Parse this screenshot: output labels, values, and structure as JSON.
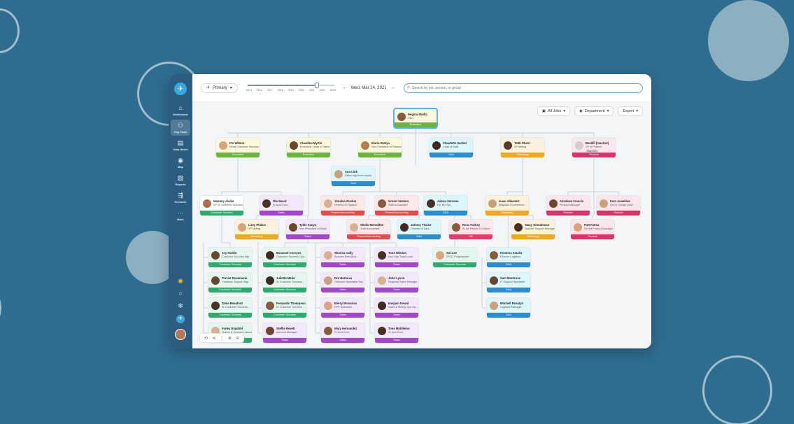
{
  "header": {
    "view_label": "Primary",
    "timeline_years": [
      "2013",
      "2016",
      "2017",
      "2018",
      "2019",
      "2020",
      "2021",
      "2022",
      "2023"
    ],
    "timeline_position": 0.8,
    "date": "Wed, Mar 24, 2021",
    "search_placeholder": "Search by job, person, or group"
  },
  "sidebar": {
    "items": [
      {
        "label": "Dashboard",
        "icon": "home-icon"
      },
      {
        "label": "Org Chart",
        "icon": "org-chart-icon"
      },
      {
        "label": "Data Sheet",
        "icon": "data-sheet-icon"
      },
      {
        "label": "Map",
        "icon": "map-pin-icon"
      },
      {
        "label": "Reports",
        "icon": "reports-icon"
      },
      {
        "label": "Scenario",
        "icon": "scenario-icon"
      },
      {
        "label": "More",
        "icon": "more-icon"
      }
    ]
  },
  "filters": {
    "jobs": "All Jobs",
    "department": "Department",
    "export": "Export"
  },
  "colors": {
    "Executive": "#6db33f",
    "G&A": "#2d8bd0",
    "Marketing": "#f0a822",
    "Product": "#d8336b",
    "Customer Success": "#2faa6e",
    "Sales": "#a148c9",
    "Finance/Accounting": "#e24b4b",
    "HR": "#e23c6a"
  },
  "cards": [
    {
      "id": "ceo",
      "name": "Regina Shelta",
      "title": "CEO",
      "dept": "Executive",
      "tint": "#fbf7dc",
      "skin": "#8a5a3c"
    },
    {
      "id": "c1",
      "name": "Flo Wilmar",
      "title": "Head Customer Success",
      "dept": "Executive",
      "tint": "#fbf7dc",
      "skin": "#d9a47e"
    },
    {
      "id": "c2",
      "name": "Claudina Myrtle",
      "title": "President, Head of Sales",
      "dept": "Executive",
      "tint": "#fbf7dc",
      "skin": "#6b4630"
    },
    {
      "id": "c3",
      "name": "Elaria Zamya",
      "title": "Vice President of Finance",
      "dept": "Executive",
      "tint": "#fbf7dc",
      "skin": "#b57a52"
    },
    {
      "id": "c4",
      "name": "Claudette Sachet",
      "title": "Chief of Staff",
      "dept": "G&A",
      "tint": "#dcf6fb",
      "skin": "#3e2a1e"
    },
    {
      "id": "c5",
      "name": "Tabb Sharri",
      "title": "VP Mkting",
      "dept": "Marketing",
      "tint": "#fbf1dc",
      "skin": "#5a3a28"
    },
    {
      "id": "c6",
      "name": "Bealifil (Inactive)",
      "title": "VP of Product",
      "dept": "Product",
      "tint": "#fbe6ec",
      "skin": "#cfcfcf",
      "badge": "May 2021"
    },
    {
      "id": "ea",
      "name": "Ann Link",
      "title": "Office Mgr/Exec Assist",
      "dept": "G&A",
      "tint": "#dcf6fb",
      "skin": "#c9a17e"
    },
    {
      "id": "r1",
      "name": "Mommy Alsike",
      "title": "VP of Customer Success",
      "dept": "Customer Success",
      "tint": "#ffffff",
      "skin": "#a8704e"
    },
    {
      "id": "r2",
      "name": "Ola Wood",
      "title": "Sr Acct Exec",
      "dept": "Sales",
      "tint": "#f3e8fb",
      "skin": "#4a3024"
    },
    {
      "id": "r3",
      "name": "Yenelon Rocker",
      "title": "Director of Finance",
      "dept": "Finance/Accounting",
      "tint": "#fbe8e8",
      "skin": "#d9b094"
    },
    {
      "id": "r4",
      "name": "Grezel Ventura",
      "title": "Staff Accountant",
      "dept": "Finance/Accounting",
      "tint": "#fbe8e8",
      "skin": "#8a5a3c"
    },
    {
      "id": "r5",
      "name": "Adena Sorvena",
      "title": "Dir. Biz Sys",
      "dept": "G&A",
      "tint": "#dcf6fb",
      "skin": "#4a3024"
    },
    {
      "id": "r6",
      "name": "Isaac Allaanert",
      "title": "Mktplace Ecommerce ...",
      "dept": "Marketing",
      "tint": "#fbf1dc",
      "skin": "#c9a17e"
    },
    {
      "id": "r7",
      "name": "Abraham Francis",
      "title": "Product Manager",
      "dept": "Product",
      "tint": "#fbe6ec",
      "skin": "#6b4630"
    },
    {
      "id": "r8",
      "name": "Fern Anaaklue",
      "title": "UI/UX Design Lead",
      "dept": "Product",
      "tint": "#fbe6ec",
      "skin": "#c9a17e"
    },
    {
      "id": "s1",
      "name": "Lizzy Plakus",
      "title": "VP Mkting",
      "dept": "Marketing",
      "tint": "#fbf1dc",
      "skin": "#d9a47e"
    },
    {
      "id": "s2",
      "name": "Tyble Sanyo",
      "title": "Vice President of Sales",
      "dept": "Sales",
      "tint": "#f3e8fb",
      "skin": "#6b4630"
    },
    {
      "id": "s3",
      "name": "Shella Meredithe",
      "title": "Staff Accountant",
      "dept": "Finance/Accounting",
      "tint": "#fbe8e8",
      "skin": "#d9b094"
    },
    {
      "id": "s4",
      "name": "Johnny Thaine",
      "title": "Director of Data",
      "dept": "G&A",
      "tint": "#dcf6fb",
      "skin": "#3e2a1e"
    },
    {
      "id": "s5",
      "name": "Ross Forkey",
      "title": "Sr Dir People & Culture",
      "dept": "HR",
      "tint": "#fbe6ec",
      "skin": "#8a5a3c"
    },
    {
      "id": "s6",
      "name": "Stasy Hinnahman",
      "title": "Teacher Support Manager",
      "dept": "Marketing",
      "tint": "#fbf1dc",
      "skin": "#4a3024"
    },
    {
      "id": "s7",
      "name": "Patt Fatma",
      "title": "Senior Product Manager",
      "dept": "Product",
      "tint": "#fbe6ec",
      "skin": "#d9a47e"
    },
    {
      "id": "t1",
      "name": "Joy Harkin",
      "title": "Customer Success Mgr",
      "dept": "Customer Success",
      "tint": "#e3f7ee",
      "skin": "#6b4630"
    },
    {
      "id": "t2",
      "name": "Emanuel Cornyns",
      "title": "Customer Success Ops...",
      "dept": "Customer Success",
      "tint": "#e3f7ee",
      "skin": "#3e2a1e"
    },
    {
      "id": "t3",
      "name": "Sharisa Colly",
      "title": "Account Executive",
      "dept": "Sales",
      "tint": "#f3e8fb",
      "skin": "#d9b094"
    },
    {
      "id": "t4",
      "name": "Tone Wiedon",
      "title": "Acct Mgr Team Lead",
      "dept": "Sales",
      "tint": "#f3e8fb",
      "skin": "#4a3024"
    },
    {
      "id": "t5",
      "name": "Sol Lee",
      "title": "SFDC Programmer",
      "dept": "Customer Success",
      "tint": "#e3f7ee",
      "skin": "#d9a47e"
    },
    {
      "id": "t6",
      "name": "Kimerea Amalia",
      "title": "Director Logistics",
      "dept": "G&A",
      "tint": "#dcf6fb",
      "skin": "#8a5a3c"
    },
    {
      "id": "u1",
      "name": "Trevier Rosemarie",
      "title": "Customer Support Mgr",
      "dept": "Customer Success",
      "tint": "#e3f7ee",
      "skin": "#6b4630"
    },
    {
      "id": "u2",
      "name": "Julietta Mede",
      "title": "Sr Customer Success ...",
      "dept": "Customer Success",
      "tint": "#e3f7ee",
      "skin": "#3e2a1e"
    },
    {
      "id": "u3",
      "name": "Dru Berbova",
      "title": "Outreach Specialist Tea...",
      "dept": "Sales",
      "tint": "#f3e8fb",
      "skin": "#c9a17e"
    },
    {
      "id": "u4",
      "name": "John Lyson",
      "title": "Regional Sales Manager",
      "dept": "Sales",
      "tint": "#f3e8fb",
      "skin": "#d9b094"
    },
    {
      "id": "u5",
      "name": "Sam Montrose",
      "title": "IT Support Specialist",
      "dept": "G&A",
      "tint": "#dcf6fb",
      "skin": "#6b4630"
    },
    {
      "id": "v1",
      "name": "Tania Beaufont",
      "title": "Sr Customer Success ...",
      "dept": "Customer Success",
      "tint": "#e3f7ee",
      "skin": "#4a3024"
    },
    {
      "id": "v2",
      "name": "Fernando Thompson",
      "title": "Sr Customer Success ...",
      "dept": "Customer Success",
      "tint": "#e3f7ee",
      "skin": "#8a5a3c"
    },
    {
      "id": "v3",
      "name": "Elerryl Rosarios",
      "title": "RFP Specialist",
      "dept": "Sales",
      "tint": "#f3e8fb",
      "skin": "#d9a47e"
    },
    {
      "id": "v4",
      "name": "Imnjaan Kewal",
      "title": "Sales & Mkting Ops Sp...",
      "dept": "Sales",
      "tint": "#f3e8fb",
      "skin": "#3e2a1e"
    },
    {
      "id": "v5",
      "name": "Mitchell Rosalyn",
      "title": "Logistics Manager",
      "dept": "G&A",
      "tint": "#dcf6fb",
      "skin": "#c9a17e"
    },
    {
      "id": "w1",
      "name": "Farley Engdahl",
      "title": "Trainer & Teacher Liaison",
      "dept": "Customer Success",
      "tint": "#e3f7ee",
      "skin": "#d9b094"
    },
    {
      "id": "w2",
      "name": "Steffie Revell",
      "title": "Account Manager",
      "dept": "Sales",
      "tint": "#f3e8fb",
      "skin": "#6b4630"
    },
    {
      "id": "w3",
      "name": "Mary Hernandez",
      "title": "Sr Acct Exec",
      "dept": "Sales",
      "tint": "#f3e8fb",
      "skin": "#8a5a3c"
    },
    {
      "id": "w4",
      "name": "Tone Middleton",
      "title": "Sr Acct Exec",
      "dept": "Sales",
      "tint": "#f3e8fb",
      "skin": "#4a3024"
    }
  ]
}
